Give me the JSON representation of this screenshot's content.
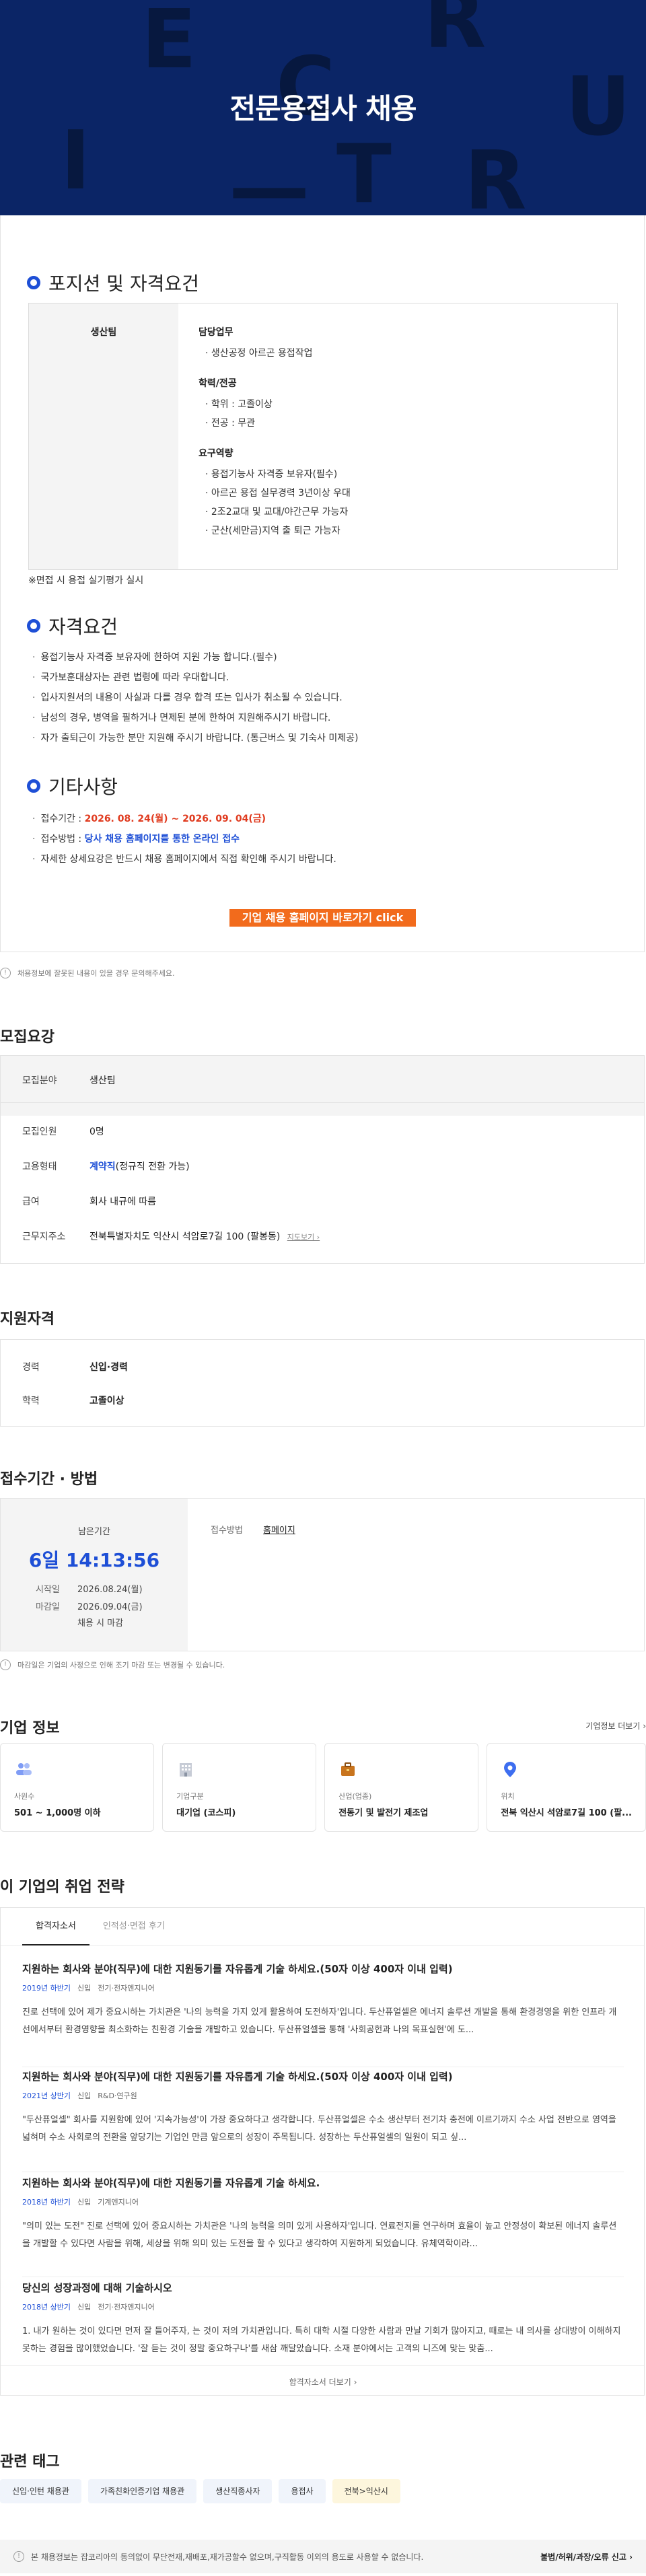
{
  "hero": {
    "title": "전문용접사 채용",
    "deco_letters": [
      "E",
      "R",
      "C",
      "U",
      "I",
      "T",
      "R",
      "—"
    ]
  },
  "position": {
    "heading": "포지션 및 자격요건",
    "team": "생산팀",
    "groups": [
      {
        "title": "담당업무",
        "items": [
          "· 생산공정 아르곤 용접작업"
        ]
      },
      {
        "title": "학력/전공",
        "items": [
          "· 학위 : 고졸이상",
          "· 전공 : 무관"
        ]
      },
      {
        "title": "요구역량",
        "items": [
          "· 용접기능사 자격증 보유자(필수)",
          "· 아르곤 용접 실무경력 3년이상 우대",
          "· 2조2교대 및 교대/야간근무 가능자",
          "· 군산(세만금)지역 출 퇴근 가능자"
        ]
      }
    ],
    "note": "※면접 시 용접 실기평가 실시"
  },
  "qualification": {
    "heading": "자격요건",
    "items": [
      "용접기능사 자격증 보유자에 한하여 지원 가능 합니다.(필수)",
      "국가보훈대상자는 관련 법령에 따라 우대합니다.",
      "입사지원서의 내용이 사실과 다를 경우 합격 또는 입사가 취소될 수 있습니다.",
      "남성의 경우, 병역을 필하거나 면제된 분에 한하여 지원해주시기 바랍니다.",
      "자가 출퇴근이 가능한 분만 지원해 주시기 바랍니다. (통근버스 및 기숙사 미제공)"
    ]
  },
  "etc": {
    "heading": "기타사항",
    "period_label": "접수기간 : ",
    "period_value": "2026. 08. 24(월) ~ 2026. 09. 04(금)",
    "method_label": "접수방법 : ",
    "method_value": "당사 채용 홈페이지를 통한 온라인 접수",
    "detail": "자세한 상세요강은 반드시 채용 홈페이지에서 직접 확인해 주시기 바랍니다.",
    "home_button": "기업 채용 홈페이지 바로가기 click"
  },
  "footnote": "채용정보에 잘못된 내용이 있을 경우 문의해주세요.",
  "summary": {
    "heading": "모집요강",
    "field_label": "모집분야",
    "field_value": "생산팀",
    "rows": [
      {
        "k": "모집인원",
        "v": "0명"
      },
      {
        "k": "고용형태",
        "v": "계약직",
        "v2": "(정규직 전환 가능)"
      },
      {
        "k": "급여",
        "v": "회사 내규에 따름"
      },
      {
        "k": "근무지주소",
        "v": "전북특별자치도 익산시 석암로7길 100 (팔봉동)",
        "v2": "지도보기 ›"
      }
    ]
  },
  "support": {
    "heading": "지원자격",
    "rows": [
      {
        "k": "경력",
        "v": "신입·경력"
      },
      {
        "k": "학력",
        "v": "고졸이상"
      }
    ]
  },
  "deadline": {
    "heading": "접수기간 · 방법",
    "remaining_label": "남은기간",
    "remaining_value": "6일 14:13:56",
    "start_label": "시작일",
    "start_value": "2026.08.24(월)",
    "end_label": "마감일",
    "end_value": "2026.09.04(금)",
    "end_note": "채용 시 마감",
    "method_label": "접수방법",
    "method_value": "홈페이지",
    "footnote": "마감일은 기업의 사정으로 인해 조기 마감 또는 변경될 수 있습니다."
  },
  "company": {
    "heading": "기업 정보",
    "more": "기업정보 더보기 ›",
    "cards": [
      {
        "icon": "people-icon",
        "label": "사원수",
        "value": "501 ~ 1,000명 이하"
      },
      {
        "icon": "building-icon",
        "label": "기업구분",
        "value": "대기업 (코스피)"
      },
      {
        "icon": "briefcase-icon",
        "label": "산업(업종)",
        "value": "전동기 및 발전기 제조업"
      },
      {
        "icon": "location-pin-icon",
        "label": "위치",
        "value": "전북 익산시 석암로7길 100 (팔..."
      }
    ]
  },
  "strategy": {
    "heading": "이 기업의 취업 전략",
    "tabs": [
      "합격자소서",
      "인적성·면접 후기"
    ],
    "items": [
      {
        "title": "지원하는 회사와 분야(직무)에 대한 지원동기를 자유롭게 기술 하세요.(50자 이상 400자 이내 입력)",
        "year": "2019년 하반기",
        "type": "신입",
        "dept": "전기·전자엔지니어",
        "body": "진로 선택에 있어 제가 중요시하는 가치관은 '나의 능력을 가지 있게 활용하여 도전하자'입니다. 두산퓨얼셀은 에너지 솔루션 개발을 통해 환경경영을 위한 인프라 개선에서부터 환경영향을 최소화하는 친환경 기술을 개발하고 있습니다. 두산퓨얼셀을 통해 '사회공헌과 나의 목표실현'에 도..."
      },
      {
        "title": "지원하는 회사와 분야(직무)에 대한 지원동기를 자유롭게 기술 하세요.(50자 이상 400자 이내 입력)",
        "year": "2021년 상반기",
        "type": "신입",
        "dept": "R&D·연구원",
        "body": "\"두산퓨얼셀\" 회사를 지원함에 있어 '지속가능성'이 가장 중요하다고 생각합니다. 두산퓨얼셀은 수소 생산부터 전기차 충전에 이르기까지 수소 사업 전반으로 영역을 넓혀며 수소 사회로의 전환을 앞당기는 기업인 만큼 앞으로의 성장이 주목됩니다. 성장하는 두산퓨얼셀의 일원이 되고 싶..."
      },
      {
        "title": "지원하는 회사와 분야(직무)에 대한 지원동기를 자유롭게 기술 하세요.",
        "year": "2018년 하반기",
        "type": "신입",
        "dept": "기계엔지니어",
        "body": "\"의미 있는 도전\" 진로 선택에 있어 중요시하는 가치관은 '나의 능력을 의미 있게 사용하자'입니다. 연료전지를 연구하며 효율이 높고 안정성이 확보된 에너지 솔루션을 개발할 수 있다면 사람을 위해, 세상을 위해 의미 있는 도전을 할 수 있다고 생각하여 지원하게 되었습니다. 유체역학이라..."
      },
      {
        "title": "당신의 성장과정에 대해 기술하시오",
        "year": "2018년 상반기",
        "type": "신입",
        "dept": "전기·전자엔지니어",
        "body": "1. 내가 원하는 것이 있다면 먼저 잘 들어주자, 는 것이 저의 가치관입니다. 특히 대학 시절 다양한 사람과 만날 기회가 많아지고, 때로는 내 의사를 상대방이 이해하지 못하는 경험을 많이했었습니다. '잘 듣는 것이 정말 중요하구나'를 새삼 깨달았습니다. 소재 분야에서는 고객의 니즈에 맞는 맞춤..."
      }
    ],
    "more": "합격자소서 더보기 ›"
  },
  "tags": {
    "heading": "관련 태그",
    "items": [
      "신입·인턴 채용관",
      "가족친화인증기업 채용관",
      "생산직종사자",
      "용접사",
      "전북>익산시"
    ]
  },
  "bottom_bar": {
    "text": "본 채용정보는 잡코리아의 동의없이 무단전재,재배포,재가공할수 없으며,구직활동 이외의 용도로 사용할 수 없습니다.",
    "report": "불법/허위/과장/오류 신고 ›"
  }
}
